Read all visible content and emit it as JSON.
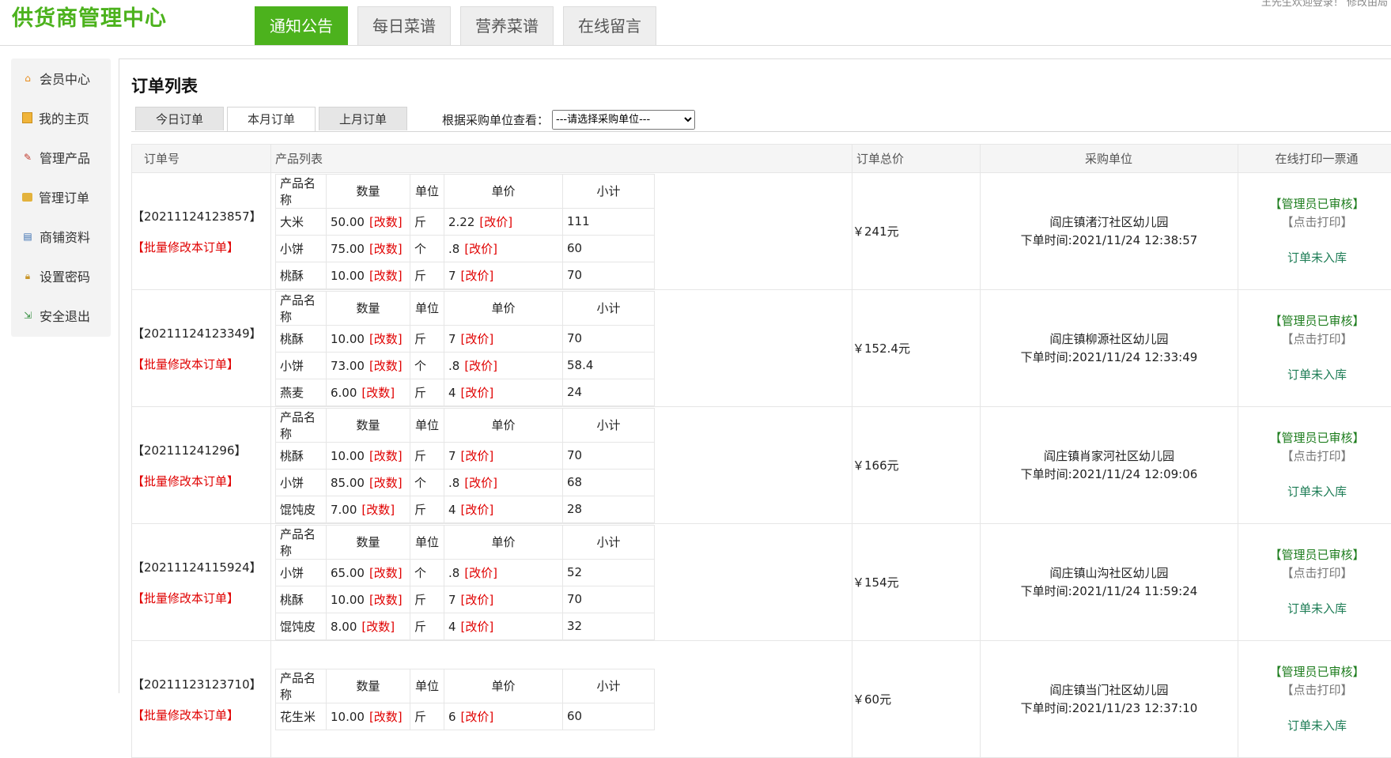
{
  "header": {
    "logo": "供货商管理中心",
    "top_right": "王先生欢迎登录！ 修改由局",
    "nav": [
      {
        "label": "通知公告",
        "active": true
      },
      {
        "label": "每日菜谱",
        "active": false
      },
      {
        "label": "营养菜谱",
        "active": false
      },
      {
        "label": "在线留言",
        "active": false
      }
    ]
  },
  "sidebar": {
    "items": [
      {
        "label": "会员中心",
        "icon": "home-icon"
      },
      {
        "label": "我的主页",
        "icon": "page-icon"
      },
      {
        "label": "管理产品",
        "icon": "edit-icon"
      },
      {
        "label": "管理订单",
        "icon": "orders-icon"
      },
      {
        "label": "商铺资料",
        "icon": "shop-icon"
      },
      {
        "label": "设置密码",
        "icon": "lock-icon"
      },
      {
        "label": "安全退出",
        "icon": "exit-icon"
      }
    ]
  },
  "main": {
    "title": "订单列表",
    "tabs": [
      {
        "label": "今日订单",
        "active": false
      },
      {
        "label": "本月订单",
        "active": true
      },
      {
        "label": "上月订单",
        "active": false
      }
    ],
    "filter_label": "根据采购单位查看：",
    "filter_selected": "---请选择采购单位---",
    "columns": [
      "订单号",
      "产品列表",
      "订单总价",
      "采购单位",
      "在线打印一票通"
    ],
    "product_columns": [
      "产品名称",
      "数量",
      "单位",
      "单价",
      "小计"
    ],
    "edit_qty_label": "[改数]",
    "edit_price_label": "[改价]",
    "batch_edit_label": "【批量修改本订单】",
    "approved_label": "【管理员已审核】",
    "print_label": "【点击打印】",
    "unstocked_label": "订单未入库",
    "orders": [
      {
        "id": "【20211124123857】",
        "items": [
          {
            "name": "大米",
            "qty": "50.00",
            "unit": "斤",
            "price": "2.22",
            "subtotal": "111"
          },
          {
            "name": "小饼",
            "qty": "75.00",
            "unit": "个",
            "price": ".8",
            "subtotal": "60"
          },
          {
            "name": "桃酥",
            "qty": "10.00",
            "unit": "斤",
            "price": "7",
            "subtotal": "70"
          }
        ],
        "total": "￥241元",
        "buyer": "阎庄镇渚汀社区幼儿园",
        "time": "下单时间:2021/11/24 12:38:57"
      },
      {
        "id": "【20211124123349】",
        "items": [
          {
            "name": "桃酥",
            "qty": "10.00",
            "unit": "斤",
            "price": "7",
            "subtotal": "70"
          },
          {
            "name": "小饼",
            "qty": "73.00",
            "unit": "个",
            "price": ".8",
            "subtotal": "58.4"
          },
          {
            "name": "燕麦",
            "qty": "6.00",
            "unit": "斤",
            "price": "4",
            "subtotal": "24"
          }
        ],
        "total": "￥152.4元",
        "buyer": "阎庄镇柳源社区幼儿园",
        "time": "下单时间:2021/11/24 12:33:49"
      },
      {
        "id": "【202111241296】",
        "items": [
          {
            "name": "桃酥",
            "qty": "10.00",
            "unit": "斤",
            "price": "7",
            "subtotal": "70"
          },
          {
            "name": "小饼",
            "qty": "85.00",
            "unit": "个",
            "price": ".8",
            "subtotal": "68"
          },
          {
            "name": "馄饨皮",
            "qty": "7.00",
            "unit": "斤",
            "price": "4",
            "subtotal": "28"
          }
        ],
        "total": "￥166元",
        "buyer": "阎庄镇肖家河社区幼儿园",
        "time": "下单时间:2021/11/24 12:09:06"
      },
      {
        "id": "【20211124115924】",
        "items": [
          {
            "name": "小饼",
            "qty": "65.00",
            "unit": "个",
            "price": ".8",
            "subtotal": "52"
          },
          {
            "name": "桃酥",
            "qty": "10.00",
            "unit": "斤",
            "price": "7",
            "subtotal": "70"
          },
          {
            "name": "馄饨皮",
            "qty": "8.00",
            "unit": "斤",
            "price": "4",
            "subtotal": "32"
          }
        ],
        "total": "￥154元",
        "buyer": "阎庄镇山沟社区幼儿园",
        "time": "下单时间:2021/11/24 11:59:24"
      },
      {
        "id": "【20211123123710】",
        "items": [
          {
            "name": "花生米",
            "qty": "10.00",
            "unit": "斤",
            "price": "6",
            "subtotal": "60"
          }
        ],
        "total": "￥60元",
        "buyer": "阎庄镇当门社区幼儿园",
        "time": "下单时间:2021/11/23 12:37:10"
      }
    ]
  }
}
